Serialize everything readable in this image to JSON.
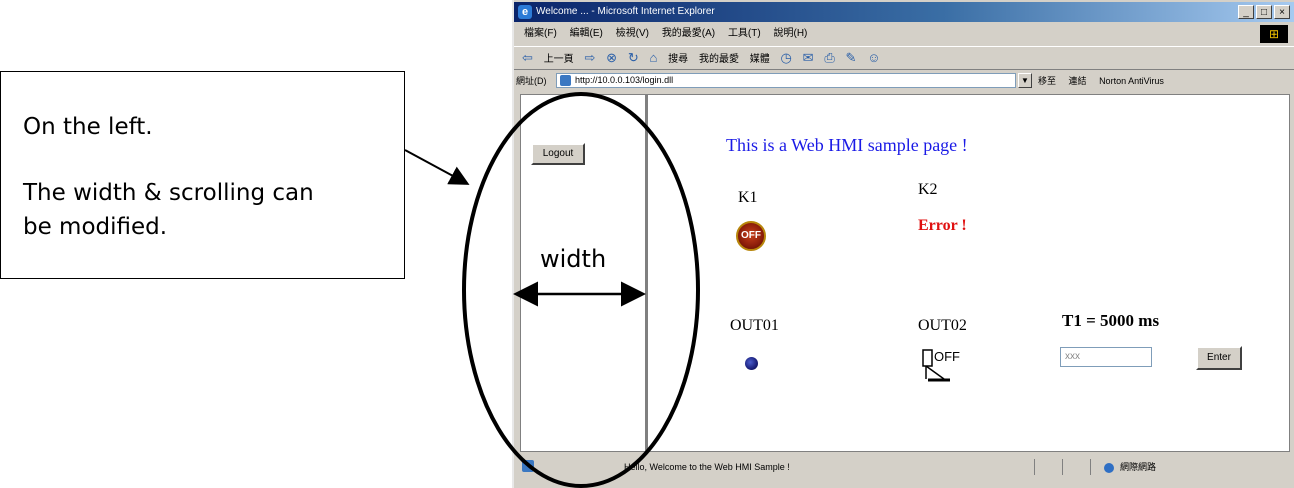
{
  "annotation": {
    "line1": "On the left.",
    "line2": "The width & scrolling can",
    "line3": "be modified.",
    "width_label": "width"
  },
  "window": {
    "title": "Welcome ... - Microsoft Internet Explorer",
    "controls": [
      "_",
      "□",
      "×"
    ]
  },
  "menu": {
    "items": [
      "檔案(F)",
      "編輯(E)",
      "檢視(V)",
      "我的最愛(A)",
      "工具(T)",
      "說明(H)"
    ]
  },
  "toolbar": {
    "items": [
      "上一頁",
      "搜尋",
      "我的最愛",
      "媒體"
    ]
  },
  "address": {
    "label": "網址(D)",
    "url": "http://10.0.0.103/login.dll",
    "go": "移至",
    "links": "連結",
    "norton": "Norton AntiVirus"
  },
  "left_frame": {
    "logout_label": "Logout"
  },
  "main": {
    "heading": "This is a Web HMI sample page !",
    "k1_label": "K1",
    "k1_badge": "OFF",
    "k2_label": "K2",
    "k2_status": "Error !",
    "out01_label": "OUT01",
    "out02_label": "OUT02",
    "out02_state": "OFF",
    "t1_prefix": "T1 = ",
    "t1_value": "5000 ms",
    "input_value": "xxx",
    "enter_label": "Enter"
  },
  "status": {
    "text": "Hello, Welcome to the Web HMI Sample !",
    "zone": "網際網路"
  },
  "colors": {
    "heading": "#1a1ae6",
    "error": "#e01010",
    "titlebar": "#0a246a"
  }
}
